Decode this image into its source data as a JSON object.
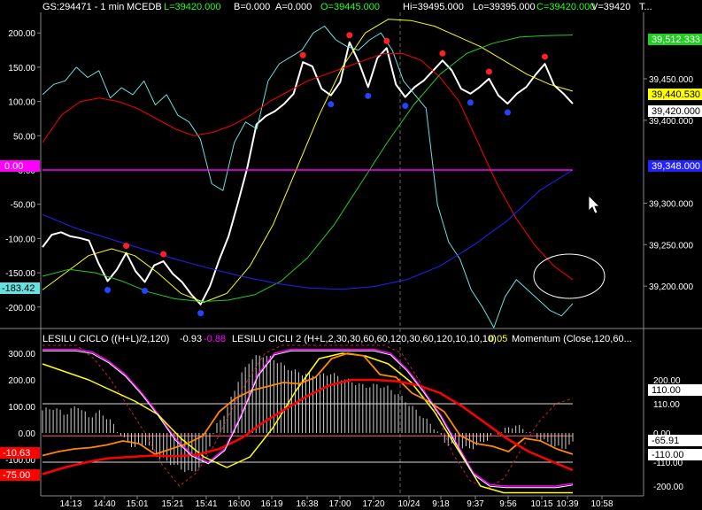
{
  "header": {
    "symbol": "GS:294471 - 1 min",
    "exchange": "MCEDB",
    "last": "L=39420.000",
    "bid": "B=0.000",
    "ask": "A=0.000",
    "open": "O=39445.000",
    "high": "Hi=39495.000",
    "low": "Lo=39395.000",
    "close": "C=39420.000",
    "volume": "V=39420",
    "trail": "T..."
  },
  "indicator_header": {
    "ciclo1": "LESILU CICLO  ((H+L)/2,120)",
    "ciclo1_v1": "-0.93",
    "ciclo1_v2": "-0.88",
    "ciclo2": "LESILU CICLI 2  (H+L,2,30,30,60,60,120,30,60,120,10,10,10)",
    "ciclo2_v": "0.05",
    "momentum": "Momentum  (Close,120,60..."
  },
  "colors": {
    "background": "#000000",
    "price": "#ffffff",
    "cyan": "#66e0e0",
    "red": "#ff0000",
    "yellow": "#ffff00",
    "green": "#22cc22",
    "blue": "#2222ff",
    "magenta": "#ff00ff",
    "orange": "#ff8800"
  },
  "left_badges": {
    "upper_zero": "0.00",
    "upper_cyan": "-183.42",
    "lower_1": "-10.63",
    "lower_2": "-75.00"
  },
  "right_badges": {
    "green": "39,512.333",
    "blue": "39,348.000",
    "yellow": "39,440.530",
    "price": "39,420.000",
    "lower_110": "110.00",
    "lower_momentum": "-65.91",
    "lower_neg110": "-110.00"
  },
  "chart_data": [
    {
      "type": "line",
      "title": "GS:294471 - 1 min",
      "x_ticks": [
        "14:13",
        "14:40",
        "15:01",
        "15:21",
        "15:41",
        "16:00",
        "16:19",
        "16:38",
        "17:00",
        "17:20",
        "10/24",
        "9:18",
        "9:37",
        "9:56",
        "10:15",
        "10:39",
        "10:58"
      ],
      "left_axis_ticks": [
        "200.00",
        "150.00",
        "100.00",
        "50.00",
        "0.00",
        "-50.00",
        "-100.00",
        "-150.00",
        "-200.00"
      ],
      "right_axis_ticks": [
        "39,450.000",
        "39,400.000",
        "39,300.000",
        "39,250.000",
        "39,200.000"
      ],
      "ylim_left": [
        -230,
        230
      ],
      "ylim_right": [
        39150,
        39530
      ],
      "series": [
        {
          "name": "Price",
          "axis": "right",
          "color": "#ffffff",
          "values": [
            39247,
            39262,
            39265,
            39260,
            39258,
            39255,
            39228,
            39206,
            39220,
            39240,
            39218,
            39205,
            39225,
            39230,
            39215,
            39205,
            39190,
            39178,
            39200,
            39232,
            39260,
            39300,
            39342,
            39395,
            39405,
            39411,
            39420,
            39432,
            39470,
            39465,
            39438,
            39430,
            39446,
            39494,
            39470,
            39440,
            39475,
            39487,
            39443,
            39428,
            39440,
            39448,
            39460,
            39472,
            39460,
            39438,
            39432,
            39440,
            39450,
            39430,
            39420,
            39432,
            39440,
            39455,
            39468,
            39442,
            39432,
            39420
          ]
        },
        {
          "name": "LESILU CICLO",
          "axis": "left",
          "color": "#66e0e0",
          "values": [
            110,
            125,
            130,
            150,
            135,
            145,
            105,
            120,
            110,
            130,
            95,
            110,
            80,
            70,
            45,
            -20,
            -30,
            40,
            70,
            60,
            130,
            155,
            165,
            175,
            200,
            210,
            190,
            180,
            175,
            190,
            200,
            175,
            130,
            110,
            90,
            -50,
            -105,
            -130,
            -175,
            -200,
            -230,
            -185,
            -160,
            -175,
            -190,
            -205,
            -213,
            -195
          ]
        },
        {
          "name": "Red",
          "axis": "left",
          "color": "#ff0000",
          "values": [
            40,
            80,
            100,
            105,
            100,
            90,
            75,
            60,
            50,
            55,
            65,
            80,
            100,
            115,
            130,
            140,
            150,
            160,
            170,
            170,
            160,
            135,
            100,
            40,
            -20,
            -70,
            -110,
            -140,
            -160
          ]
        },
        {
          "name": "Yellow",
          "axis": "left",
          "color": "#ffff00",
          "values": [
            -175,
            -150,
            -125,
            -115,
            -125,
            -150,
            -180,
            -193,
            -180,
            -140,
            -80,
            0,
            80,
            150,
            200,
            220,
            218,
            210,
            195,
            180,
            160,
            140,
            125,
            115
          ]
        },
        {
          "name": "Green",
          "axis": "left",
          "color": "#22cc22",
          "values": [
            -155,
            -145,
            -150,
            -162,
            -178,
            -188,
            -192,
            -190,
            -182,
            -162,
            -128,
            -80,
            -20,
            40,
            95,
            140,
            170,
            185,
            194,
            196,
            197
          ]
        },
        {
          "name": "Blue",
          "axis": "left",
          "color": "#2222ff",
          "values": [
            -65,
            -85,
            -100,
            -115,
            -130,
            -143,
            -155,
            -165,
            -172,
            -174,
            -170,
            -160,
            -140,
            -110,
            -75,
            -30,
            0
          ]
        },
        {
          "name": "Zero",
          "axis": "left",
          "color": "#ff00ff",
          "values": [
            0,
            0
          ]
        }
      ],
      "markers": {
        "up_red": [
          [
            -75,
            -95
          ],
          [
            -92,
            -118
          ],
          [
            -140,
            -145
          ],
          [
            185,
            215
          ],
          [
            140,
            185
          ],
          [
            175
          ],
          [
            150
          ],
          [
            130
          ]
        ],
        "down_blue": []
      }
    },
    {
      "type": "line",
      "title": "LESILU CICLO / LESILU CICLI 2 / Momentum",
      "left_axis_ticks": [
        "300.00",
        "200.00",
        "100.00",
        "0.00",
        "-100.00"
      ],
      "right_axis_ticks": [
        "200.00",
        "110.00",
        "0.00",
        "-110.00",
        "-200.00"
      ],
      "ylim": [
        -230,
        330
      ],
      "levels": [
        110,
        -10.63,
        -110
      ],
      "series": [
        {
          "name": "Momentum",
          "color": "#ffffff",
          "values": [
            85,
            95,
            70,
            105,
            60,
            80,
            40,
            -20,
            -55,
            -40,
            -90,
            -110,
            -135,
            -150,
            -110,
            20,
            90,
            200,
            275,
            295,
            280,
            250,
            230,
            220,
            215,
            225,
            205,
            190,
            175,
            180,
            170,
            140,
            100,
            60,
            20,
            -40,
            -50,
            -60,
            -40,
            -10,
            10,
            30,
            10,
            -20,
            -40,
            -60,
            -40
          ]
        },
        {
          "name": "LESILU CICLO",
          "color": "#ff00ff",
          "values": [
            315,
            315,
            315,
            305,
            270,
            220,
            150,
            70,
            -20,
            -80,
            -110,
            -60,
            70,
            220,
            300,
            315,
            315,
            315,
            315,
            315,
            315,
            300,
            240,
            160,
            70,
            -40,
            -150,
            -195,
            -200,
            -200,
            -200,
            -200,
            -190
          ]
        },
        {
          "name": "LESILU CICLI 2",
          "color": "#ffff00",
          "values": [
            260,
            230,
            200,
            160,
            120,
            70,
            -20,
            -90,
            -130,
            -90,
            20,
            160,
            280,
            300,
            290,
            260,
            190,
            80,
            -60,
            -200,
            -225,
            -225,
            -225,
            -225
          ]
        },
        {
          "name": "Orange",
          "color": "#ff8800",
          "values": [
            -85,
            -70,
            -60,
            -55,
            -45,
            -30,
            -40,
            -80,
            -60,
            -40,
            -10,
            80,
            130,
            160,
            175,
            190,
            185,
            210,
            280,
            300,
            290,
            220,
            210,
            150,
            120,
            80,
            -10,
            -40,
            -50,
            -70,
            -20,
            -30,
            -60,
            -80
          ]
        },
        {
          "name": "Red",
          "color": "#ff0000",
          "values": [
            -155,
            -130,
            -110,
            -95,
            -90,
            -85,
            -88,
            -82,
            -60,
            -20,
            40,
            90,
            140,
            180,
            200,
            200,
            195,
            180,
            150,
            100,
            40,
            -20,
            -70,
            -105,
            -140
          ]
        }
      ]
    }
  ]
}
